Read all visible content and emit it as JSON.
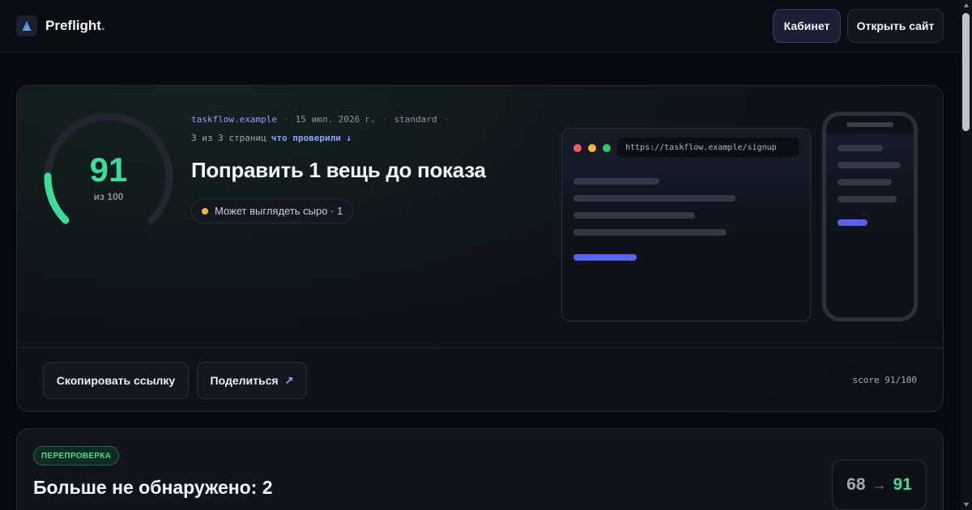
{
  "header": {
    "brand": "Preflight",
    "brand_suffix": ".",
    "cabinet_label": "Кабинет",
    "open_site_label": "Открыть сайт"
  },
  "report": {
    "score": 91,
    "score_max": 100,
    "score_caption": "из 100",
    "domain": "taskflow.example",
    "date": "15 июл. 2026 г.",
    "mode": "standard",
    "pages_checked": "3 из 3 страниц",
    "what_checked_link": "что проверили ↓",
    "title": "Поправить 1 вещь до показа",
    "issue_pill": "Может выглядеть сыро · 1",
    "issue_color": "#f5b53a",
    "preview_url": "https://taskflow.example/signup",
    "copy_link_label": "Скопировать ссылку",
    "share_label": "Поделиться",
    "share_icon": "↗",
    "score_note": "score 91/100",
    "accent_color": "#3ddc97"
  },
  "recheck": {
    "badge": "ПЕРЕПРОВЕРКА",
    "title": "Больше не обнаружено: 2",
    "description": "",
    "from_score": "68",
    "arrow": "→",
    "to_score": "91"
  }
}
